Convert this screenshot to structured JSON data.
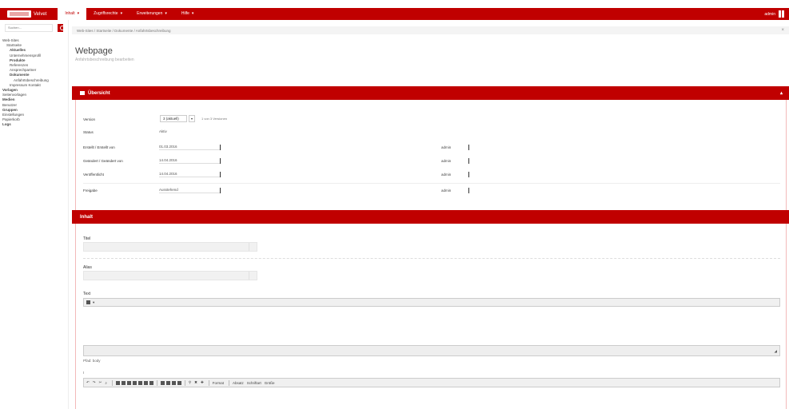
{
  "topbar": {
    "brand": "Velvet",
    "nav": [
      {
        "label": "Inhalt",
        "active": true
      },
      {
        "label": "Zugriffsrechte",
        "active": false
      },
      {
        "label": "Erweiterungen",
        "active": false
      },
      {
        "label": "Hilfe",
        "active": false
      }
    ],
    "user": "admin",
    "accent": "#c00000"
  },
  "sidebar": {
    "search_placeholder": "Suchen...",
    "tree": [
      {
        "label": "Web-Sites",
        "level": 0,
        "bold": false
      },
      {
        "label": "Startseite",
        "level": 1,
        "bold": false
      },
      {
        "label": "Aktuelles",
        "level": 2,
        "bold": true
      },
      {
        "label": "Unternehmensprofil",
        "level": 2,
        "bold": false
      },
      {
        "label": "Produkte",
        "level": 2,
        "bold": true
      },
      {
        "label": "Referenzen",
        "level": 2,
        "bold": false
      },
      {
        "label": "Ansprechpartner",
        "level": 2,
        "bold": false
      },
      {
        "label": "Dokumente",
        "level": 2,
        "bold": true
      },
      {
        "label": "Anfahrtsbeschreibung",
        "level": 3,
        "bold": false
      },
      {
        "label": "Impressum Kontakt",
        "level": 2,
        "bold": false
      },
      {
        "label": "Vorlagen",
        "level": 0,
        "bold": true
      },
      {
        "label": "Seitenvorlagen",
        "level": 0,
        "bold": false
      },
      {
        "label": "Medien",
        "level": 0,
        "bold": true
      },
      {
        "label": "Benutzer",
        "level": 0,
        "bold": false
      },
      {
        "label": "Gruppen",
        "level": 0,
        "bold": true
      },
      {
        "label": "Einstellungen",
        "level": 0,
        "bold": false
      },
      {
        "label": "Papierkorb",
        "level": 0,
        "bold": false
      },
      {
        "label": "Logs",
        "level": 0,
        "bold": true
      }
    ]
  },
  "breadcrumb": "Web-Sites / Startseite / Dokumente / Anfahrtsbeschreibung",
  "page": {
    "title": "Webpage",
    "subtitle": "Anfahrtsbeschreibung bearbeiten"
  },
  "overview": {
    "header": "Übersicht",
    "version_label": "Version",
    "version_value": "3 (aktuell)",
    "version_extra": "1 von 3 Versionen",
    "rows": [
      {
        "label": "Status",
        "value": "Aktiv"
      },
      {
        "label": "Erstellt / Erstellt von",
        "value": "01.03.2016"
      },
      {
        "label": "Geändert / Geändert von",
        "value": "14.04.2016"
      },
      {
        "label": "Veröffentlicht",
        "value": "14.04.2016"
      },
      {
        "label": "Freigabe",
        "value": "Ausstehend"
      }
    ],
    "right_rows": [
      "admin",
      "admin",
      "admin",
      "admin"
    ]
  },
  "details": {
    "header": "Inhalt",
    "field1_label": "Titel",
    "field2_label": "Alias",
    "editor_label": "Text",
    "editor_footer_right": "p",
    "note": "Pfad: body",
    "toolbar2_label": "I",
    "toolbar_items": [
      "Format",
      "Absatz",
      "Schriftart",
      "Größe"
    ]
  }
}
